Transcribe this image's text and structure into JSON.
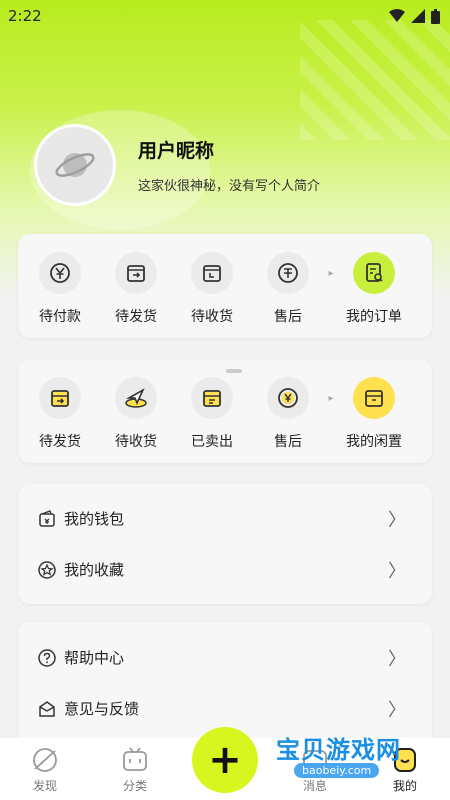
{
  "status": {
    "time": "2:22"
  },
  "profile": {
    "nickname": "用户昵称",
    "bio": "这家伙很神秘，没有写个人简介"
  },
  "orders": {
    "items": [
      {
        "label": "待付款",
        "icon": "yuan-cycle-icon"
      },
      {
        "label": "待发货",
        "icon": "box-out-icon"
      },
      {
        "label": "待收货",
        "icon": "box-clock-icon"
      },
      {
        "label": "售后",
        "icon": "after-sale-icon"
      }
    ],
    "summary": {
      "label": "我的订单",
      "icon": "order-search-icon"
    }
  },
  "sales": {
    "items": [
      {
        "label": "待发货",
        "icon": "box-arrow-icon"
      },
      {
        "label": "待收货",
        "icon": "paper-plane-icon"
      },
      {
        "label": "已卖出",
        "icon": "box-sold-icon"
      },
      {
        "label": "售后",
        "icon": "yuan-refresh-icon"
      }
    ],
    "summary": {
      "label": "我的闲置",
      "icon": "box-idle-icon"
    }
  },
  "menu1": [
    {
      "label": "我的钱包",
      "icon": "wallet-icon"
    },
    {
      "label": "我的收藏",
      "icon": "star-icon"
    }
  ],
  "menu2": [
    {
      "label": "帮助中心",
      "icon": "question-icon"
    },
    {
      "label": "意见与反馈",
      "icon": "feedback-icon"
    }
  ],
  "tabs": [
    {
      "label": "发现",
      "icon": "discover-icon"
    },
    {
      "label": "分类",
      "icon": "category-icon"
    },
    {
      "label": "",
      "icon": ""
    },
    {
      "label": "消息",
      "icon": "message-icon"
    },
    {
      "label": "我的",
      "icon": "me-icon"
    }
  ],
  "fab": {
    "label": "+"
  },
  "watermark": {
    "text": "宝贝游戏网",
    "url": "baobeiy.com"
  },
  "colors": {
    "accent": "#c8ef3b",
    "fab": "#d7f51f",
    "yellow": "#ffe150"
  }
}
